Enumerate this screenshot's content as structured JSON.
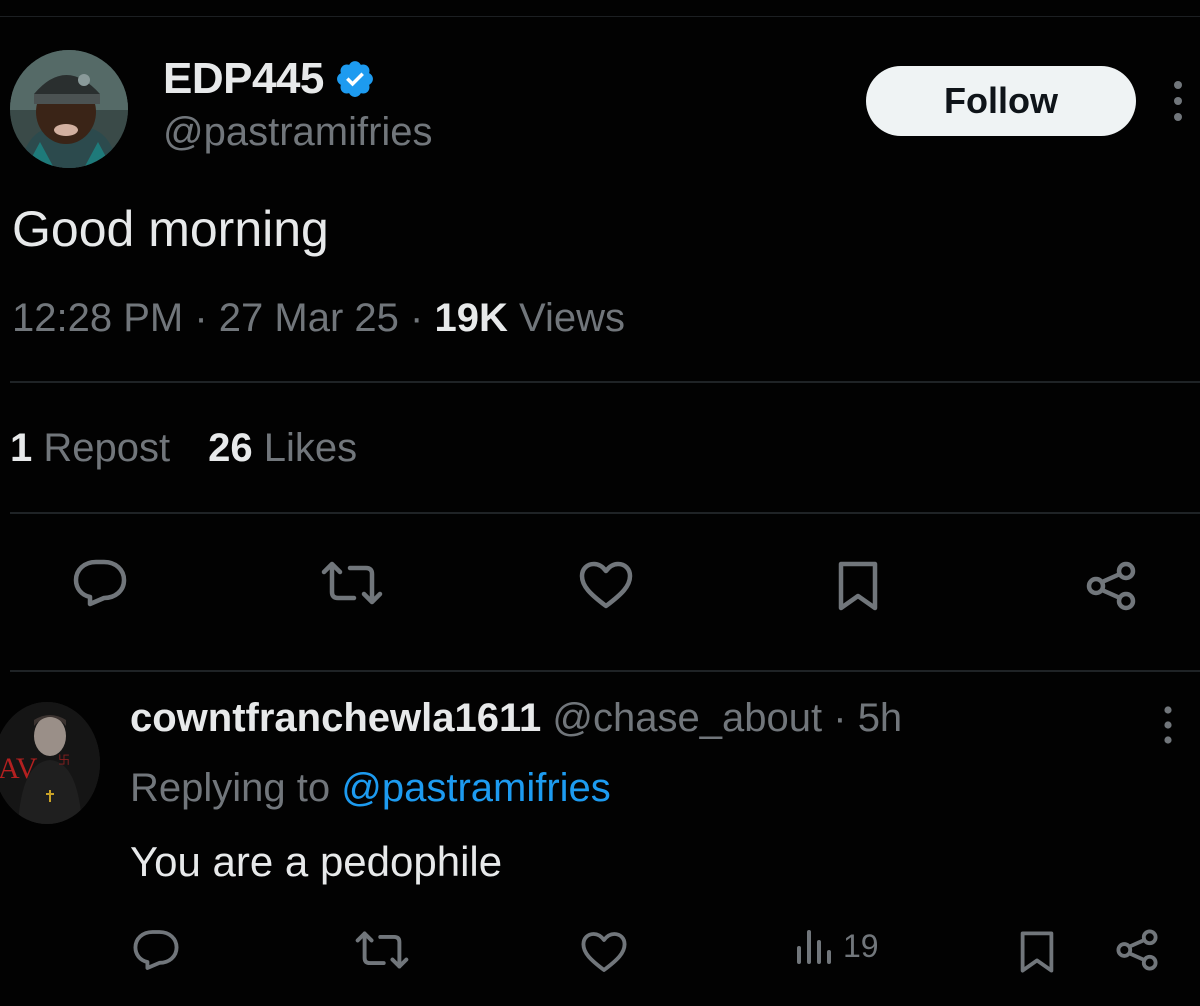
{
  "tweet": {
    "author": {
      "display_name": "EDP445",
      "handle": "@pastramifries",
      "verified": true
    },
    "follow_label": "Follow",
    "text": "Good morning",
    "time": "12:28 PM",
    "date": "27 Mar 25",
    "views_count": "19K",
    "views_label": "Views",
    "separator": "·",
    "reposts_count": "1",
    "reposts_label": "Repost",
    "likes_count": "26",
    "likes_label": "Likes"
  },
  "reply": {
    "display_name": "cowntfranchewla1611",
    "handle": "@chase_about",
    "age": "5h",
    "separator": "·",
    "replying_prefix": "Replying to",
    "replying_to": "@pastramifries",
    "text": "You are a pedophile",
    "views_count": "19"
  },
  "icons": {
    "reply": "reply-bubble-icon",
    "repost": "repost-icon",
    "like": "heart-icon",
    "bookmark": "bookmark-icon",
    "share": "share-icon",
    "views": "views-bar-icon",
    "more": "more-vertical-icon",
    "verified": "verified-badge-icon"
  },
  "colors": {
    "background": "#020202",
    "text_primary": "#e7e9ea",
    "text_secondary": "#71767b",
    "accent": "#1d9bf0",
    "follow_bg": "#eff3f4"
  }
}
